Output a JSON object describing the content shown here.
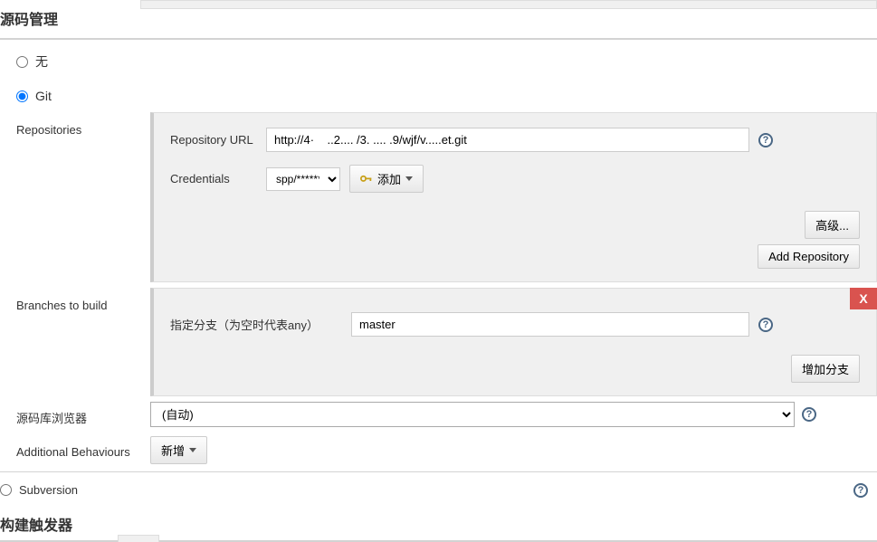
{
  "scm": {
    "title": "源码管理",
    "none_label": "无",
    "git_label": "Git",
    "repositories": {
      "label": "Repositories",
      "url_label": "Repository URL",
      "url_value": "http://4·    ..2.... /3. .... .9/wjf/v.....et.git",
      "credentials_label": "Credentials",
      "credentials_value": "spp/******",
      "add_button": "添加",
      "advanced_button": "高级...",
      "add_repo_button": "Add Repository"
    },
    "branches": {
      "label": "Branches to build",
      "branch_spec_label": "指定分支（为空时代表any）",
      "branch_value": "master",
      "add_branch_button": "增加分支",
      "close": "X"
    },
    "browser": {
      "label": "源码库浏览器",
      "value": "(自动)"
    },
    "additional": {
      "label": "Additional Behaviours",
      "add_button": "新增"
    },
    "subversion_label": "Subversion"
  },
  "build_triggers": {
    "title": "构建触发器"
  }
}
